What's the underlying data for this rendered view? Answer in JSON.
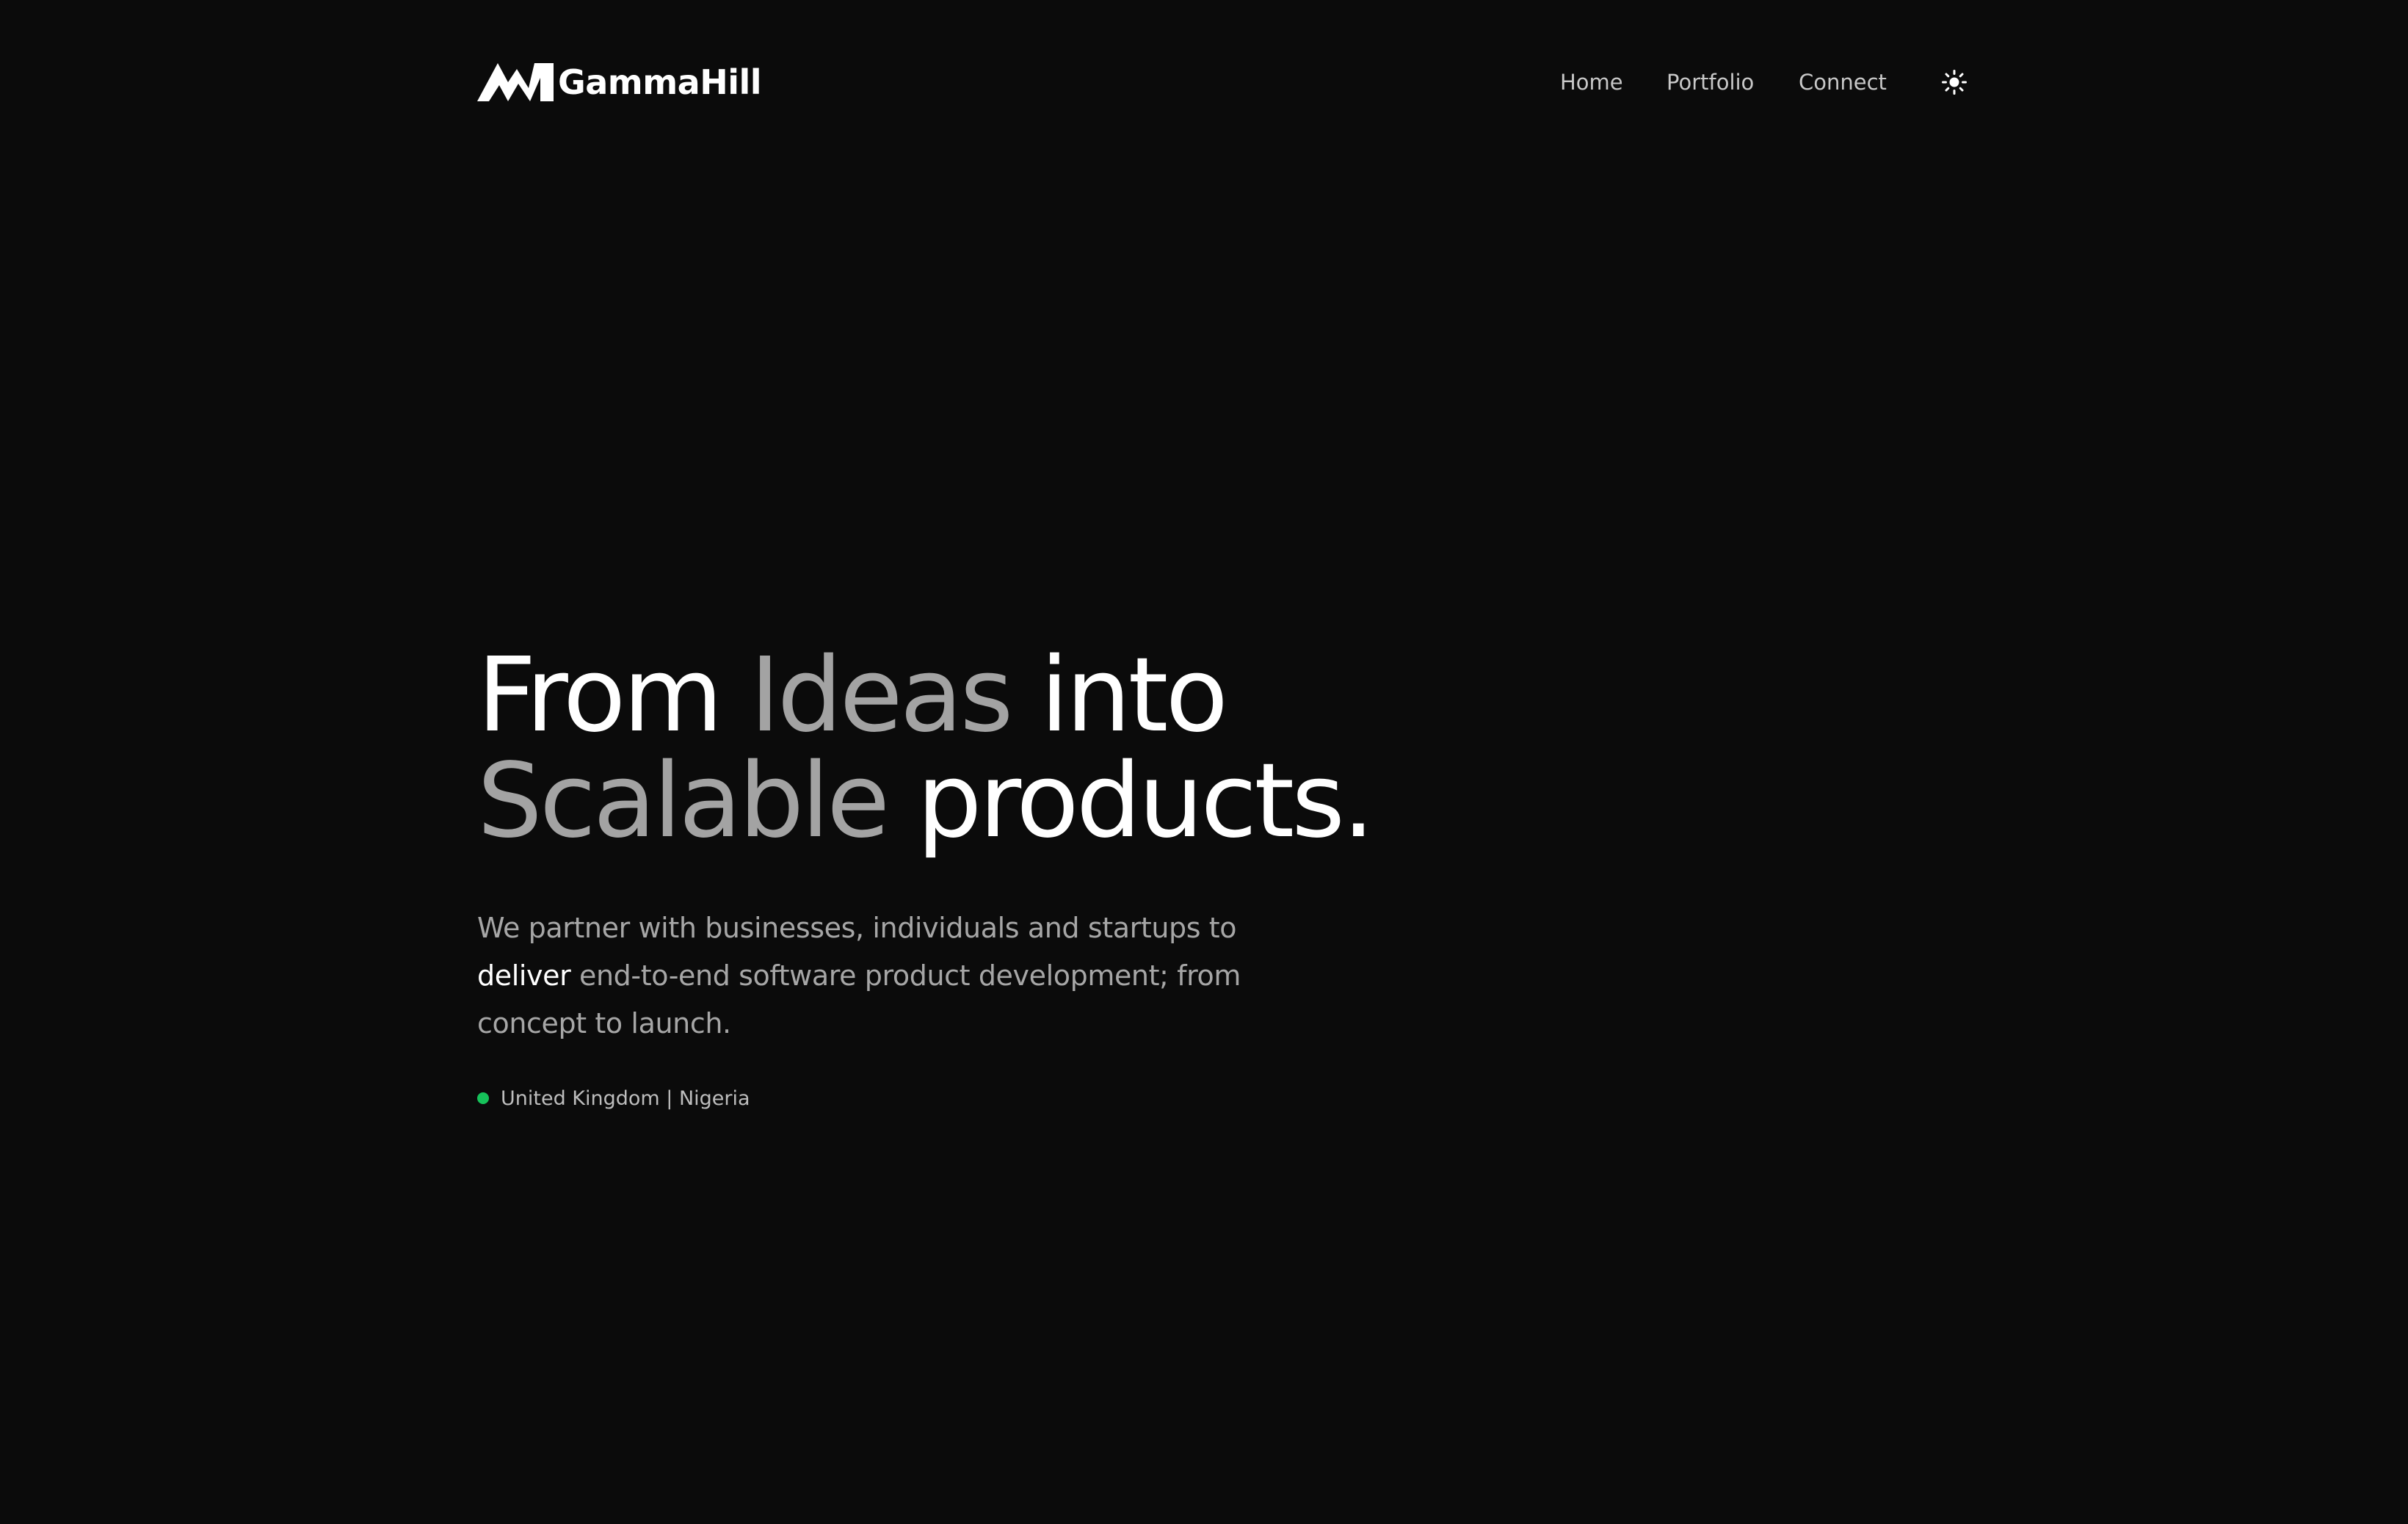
{
  "header": {
    "brand": "GammaHill",
    "nav": {
      "home": "Home",
      "portfolio": "Portfolio",
      "connect": "Connect"
    },
    "theme_toggle_icon": "sun-icon"
  },
  "hero": {
    "title": {
      "w1": "From",
      "w2": "Ideas",
      "w3": "into",
      "w4": "Scalable",
      "w5": "products."
    },
    "subtitle": {
      "part1": "We partner with businesses, individuals and startups to",
      "highlight": "deliver",
      "part2": "end-to-end software product development; from concept to launch."
    },
    "location": "United Kingdom | Nigeria"
  },
  "colors": {
    "background": "#0b0b0b",
    "text_primary": "#ffffff",
    "text_muted": "#a3a3a3",
    "status_green": "#16c25a"
  }
}
